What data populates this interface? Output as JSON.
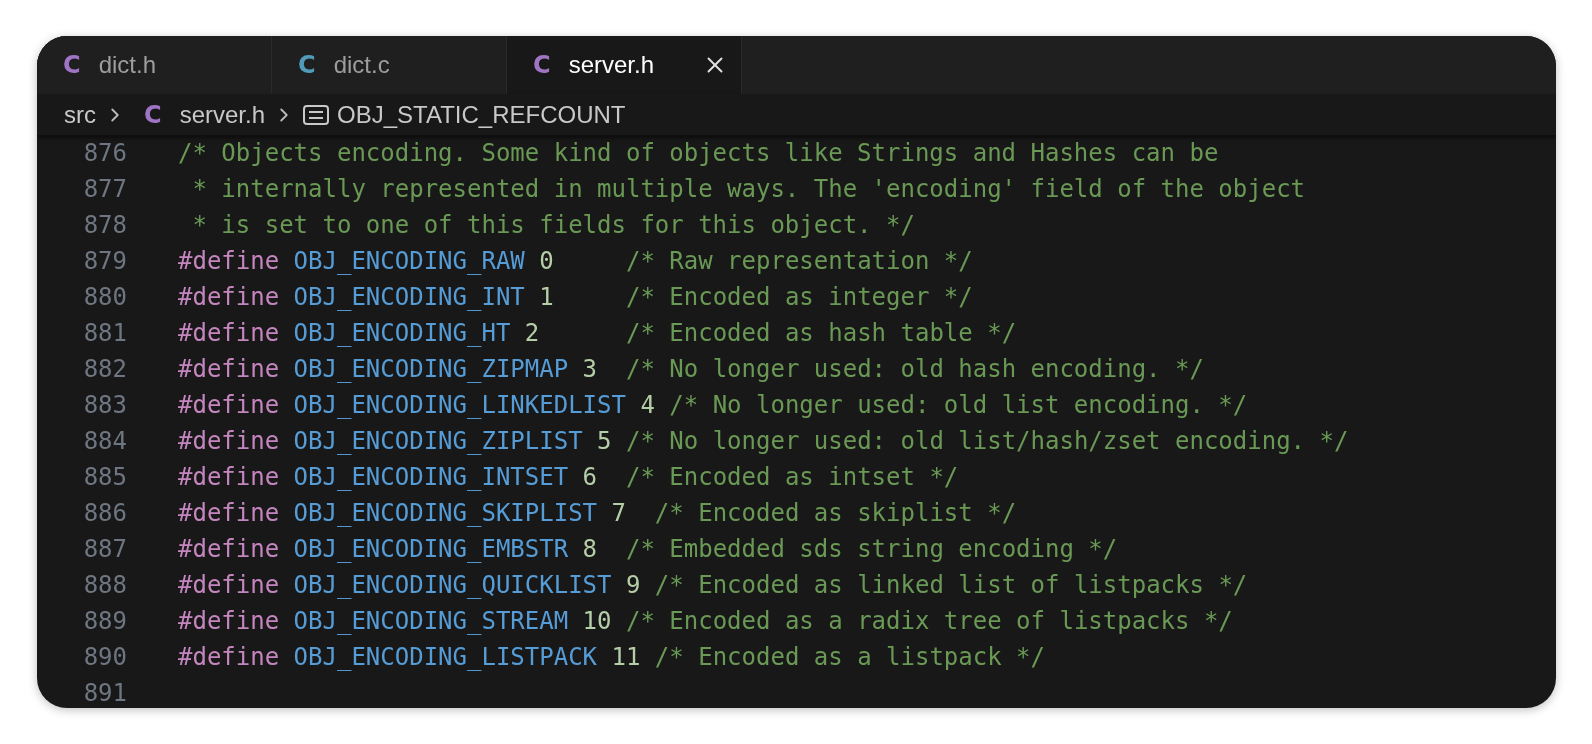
{
  "tabs": [
    {
      "icon": "C",
      "color": "#a074c4",
      "label": "dict.h",
      "selected": false
    },
    {
      "icon": "C",
      "color": "#519aba",
      "label": "dict.c",
      "selected": false
    },
    {
      "icon": "C",
      "color": "#a074c4",
      "label": "server.h",
      "selected": true
    }
  ],
  "breadcrumb": [
    {
      "kind": "folder",
      "label": "src"
    },
    {
      "kind": "file",
      "icon": "C",
      "color": "#a074c4",
      "label": "server.h"
    },
    {
      "kind": "symbol",
      "label": "OBJ_STATIC_REFCOUNT"
    }
  ],
  "code": [
    {
      "number": "876",
      "tokens": [
        {
          "kind": "comment",
          "text": "/* Objects encoding. Some kind of objects like Strings and Hashes can be"
        }
      ]
    },
    {
      "number": "877",
      "tokens": [
        {
          "kind": "comment",
          "text": " * internally represented in multiple ways. The 'encoding' field of the object"
        }
      ]
    },
    {
      "number": "878",
      "tokens": [
        {
          "kind": "comment",
          "text": " * is set to one of this fields for this object. */"
        }
      ]
    },
    {
      "number": "879",
      "tokens": [
        {
          "kind": "keyword",
          "text": "#define"
        },
        {
          "kind": "macro",
          "text": " OBJ_ENCODING_RAW"
        },
        {
          "kind": "number",
          "text": " 0"
        },
        {
          "kind": "comment",
          "text": "     /* Raw representation */"
        }
      ]
    },
    {
      "number": "880",
      "tokens": [
        {
          "kind": "keyword",
          "text": "#define"
        },
        {
          "kind": "macro",
          "text": " OBJ_ENCODING_INT"
        },
        {
          "kind": "number",
          "text": " 1"
        },
        {
          "kind": "comment",
          "text": "     /* Encoded as integer */"
        }
      ]
    },
    {
      "number": "881",
      "tokens": [
        {
          "kind": "keyword",
          "text": "#define"
        },
        {
          "kind": "macro",
          "text": " OBJ_ENCODING_HT"
        },
        {
          "kind": "number",
          "text": " 2"
        },
        {
          "kind": "comment",
          "text": "      /* Encoded as hash table */"
        }
      ]
    },
    {
      "number": "882",
      "tokens": [
        {
          "kind": "keyword",
          "text": "#define"
        },
        {
          "kind": "macro",
          "text": " OBJ_ENCODING_ZIPMAP"
        },
        {
          "kind": "number",
          "text": " 3"
        },
        {
          "kind": "comment",
          "text": "  /* No longer used: old hash encoding. */"
        }
      ]
    },
    {
      "number": "883",
      "tokens": [
        {
          "kind": "keyword",
          "text": "#define"
        },
        {
          "kind": "macro",
          "text": " OBJ_ENCODING_LINKEDLIST"
        },
        {
          "kind": "number",
          "text": " 4"
        },
        {
          "kind": "comment",
          "text": " /* No longer used: old list encoding. */"
        }
      ]
    },
    {
      "number": "884",
      "tokens": [
        {
          "kind": "keyword",
          "text": "#define"
        },
        {
          "kind": "macro",
          "text": " OBJ_ENCODING_ZIPLIST"
        },
        {
          "kind": "number",
          "text": " 5"
        },
        {
          "kind": "comment",
          "text": " /* No longer used: old list/hash/zset encoding. */"
        }
      ]
    },
    {
      "number": "885",
      "tokens": [
        {
          "kind": "keyword",
          "text": "#define"
        },
        {
          "kind": "macro",
          "text": " OBJ_ENCODING_INTSET"
        },
        {
          "kind": "number",
          "text": " 6"
        },
        {
          "kind": "comment",
          "text": "  /* Encoded as intset */"
        }
      ]
    },
    {
      "number": "886",
      "tokens": [
        {
          "kind": "keyword",
          "text": "#define"
        },
        {
          "kind": "macro",
          "text": " OBJ_ENCODING_SKIPLIST"
        },
        {
          "kind": "number",
          "text": " 7"
        },
        {
          "kind": "comment",
          "text": "  /* Encoded as skiplist */"
        }
      ]
    },
    {
      "number": "887",
      "tokens": [
        {
          "kind": "keyword",
          "text": "#define"
        },
        {
          "kind": "macro",
          "text": " OBJ_ENCODING_EMBSTR"
        },
        {
          "kind": "number",
          "text": " 8"
        },
        {
          "kind": "comment",
          "text": "  /* Embedded sds string encoding */"
        }
      ]
    },
    {
      "number": "888",
      "tokens": [
        {
          "kind": "keyword",
          "text": "#define"
        },
        {
          "kind": "macro",
          "text": " OBJ_ENCODING_QUICKLIST"
        },
        {
          "kind": "number",
          "text": " 9"
        },
        {
          "kind": "comment",
          "text": " /* Encoded as linked list of listpacks */"
        }
      ]
    },
    {
      "number": "889",
      "tokens": [
        {
          "kind": "keyword",
          "text": "#define"
        },
        {
          "kind": "macro",
          "text": " OBJ_ENCODING_STREAM"
        },
        {
          "kind": "number",
          "text": " 10"
        },
        {
          "kind": "comment",
          "text": " /* Encoded as a radix tree of listpacks */"
        }
      ]
    },
    {
      "number": "890",
      "tokens": [
        {
          "kind": "keyword",
          "text": "#define"
        },
        {
          "kind": "macro",
          "text": " OBJ_ENCODING_LISTPACK"
        },
        {
          "kind": "number",
          "text": " 11"
        },
        {
          "kind": "comment",
          "text": " /* Encoded as a listpack */"
        }
      ]
    },
    {
      "number": "891"
    }
  ]
}
